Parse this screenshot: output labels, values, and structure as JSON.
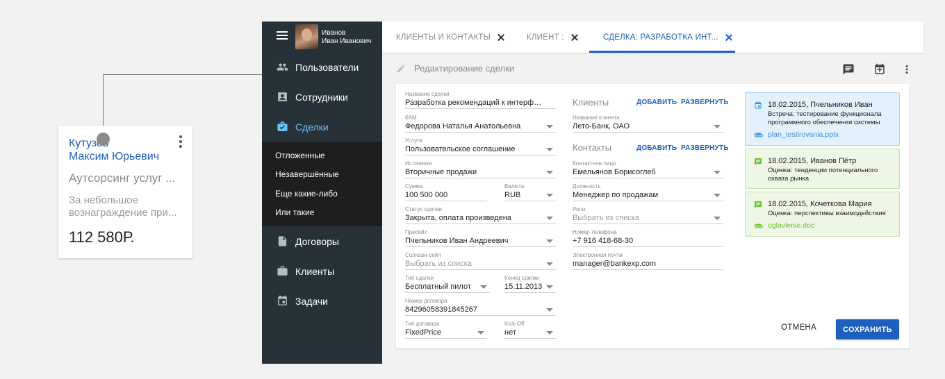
{
  "card": {
    "last_name": "Кутузов",
    "first_middle": "Максим Юрьевич",
    "company": "Аутсорсинг услуг ...",
    "desc_line1": "За небольшое",
    "desc_line2": "вознаграждение при...",
    "amount": "112 580Р."
  },
  "sidebar": {
    "user_line1": "Иванов",
    "user_line2": "Иван Иванович",
    "items": [
      {
        "label": "Пользователи",
        "icon": "people-icon"
      },
      {
        "label": "Сотрудники",
        "icon": "badge-icon"
      },
      {
        "label": "Сделки",
        "icon": "briefcase-check-icon",
        "active": true
      },
      {
        "label": "Договоры",
        "icon": "document-icon"
      },
      {
        "label": "Клиенты",
        "icon": "briefcase-icon"
      },
      {
        "label": "Задачи",
        "icon": "calendar-icon"
      }
    ],
    "subitems": [
      "Отложенные",
      "Незавершённые",
      "Еще какие-либо",
      "Или такие"
    ]
  },
  "tabs": [
    {
      "label": "КЛИЕНТЫ И КОНТАКТЫ"
    },
    {
      "label": "КЛИЕНТ :"
    },
    {
      "label": "СДЕЛКА: РАЗРАБОТКА ИНТ...",
      "active": true
    }
  ],
  "header": {
    "title": "Редактирование сделки"
  },
  "deal": {
    "name": {
      "label": "Название сделки",
      "value": "Разработка рекомендаций к интерфейса..."
    },
    "kam": {
      "label": "КАМ",
      "value": "Федорова Наталья Анатольевна"
    },
    "services": {
      "label": "Услуги",
      "value": "Пользовательское соглашение"
    },
    "sources": {
      "label": "Источники",
      "value": "Вторичные продажи"
    },
    "sum": {
      "label": "Сумма",
      "value": "100 500 000"
    },
    "currency": {
      "label": "Валюта",
      "value": "RUB"
    },
    "status": {
      "label": "Статус сделки",
      "value": "Закрыта, оплата произведена"
    },
    "presale": {
      "label": "Пресейл",
      "value": "Пчельников Иван Андреевич"
    },
    "solution_sale": {
      "label": "Солюшн-сейл",
      "value": "Выбрать из списка"
    },
    "deal_type": {
      "label": "Тип сделки",
      "value": "Бесплатный пилот"
    },
    "deal_end": {
      "label": "Конец сделки",
      "value": "15.11.2013"
    },
    "contract_number": {
      "label": "Номер договора",
      "value": "84296058391845267"
    },
    "contract_type": {
      "label": "Тип договора",
      "value": "FixedPrice"
    },
    "kickoff": {
      "label": "Kick-Off",
      "value": "нет"
    }
  },
  "clients": {
    "title": "Клиенты",
    "add": "ДОБАВИТЬ",
    "expand": "РАЗВЕРНУТЬ",
    "client_name": {
      "label": "Название клиента",
      "value": "Лето-Банк, ОАО"
    }
  },
  "contacts": {
    "title": "Контакты",
    "add": "ДОБАВИТЬ",
    "expand": "РАЗВЕРНУТЬ",
    "person": {
      "label": "Контактное лицо",
      "value": "Емельянов Борисоглеб"
    },
    "position": {
      "label": "Должность",
      "value": "Менеджер по продажам"
    },
    "roles": {
      "label": "Роли",
      "value": "Выбрать из списка"
    },
    "phone": {
      "label": "Номер телефона",
      "value": "+7 916 418-68-30"
    },
    "email": {
      "label": "Электронная почта",
      "value": "manager@bankexp.com"
    }
  },
  "activities": [
    {
      "title": "18.02.2015, Пчельников Иван",
      "text": "Встреча: тестирование функционала программного обеспечения системы",
      "attachment": "plan_testirovania.pptx",
      "color": "#e3f1fc"
    },
    {
      "title": "18.02.2015, Иванов Пётр",
      "text": "Оценка: тенденции потенциального охвата рынка",
      "attachment": "",
      "color": "#eef7e5"
    },
    {
      "title": "18.02.2015, Кочеткова Мария",
      "text": "Оценка: перспективы взаимодействия",
      "attachment": "oglavlenie.doc",
      "color": "#eef7e5"
    }
  ],
  "buttons": {
    "cancel": "ОТМЕНА",
    "save": "СОХРАНИТЬ"
  },
  "colors": {
    "primary": "#1e5fbf",
    "sidebar": "#263238",
    "active_nav": "#6ec1f7"
  }
}
